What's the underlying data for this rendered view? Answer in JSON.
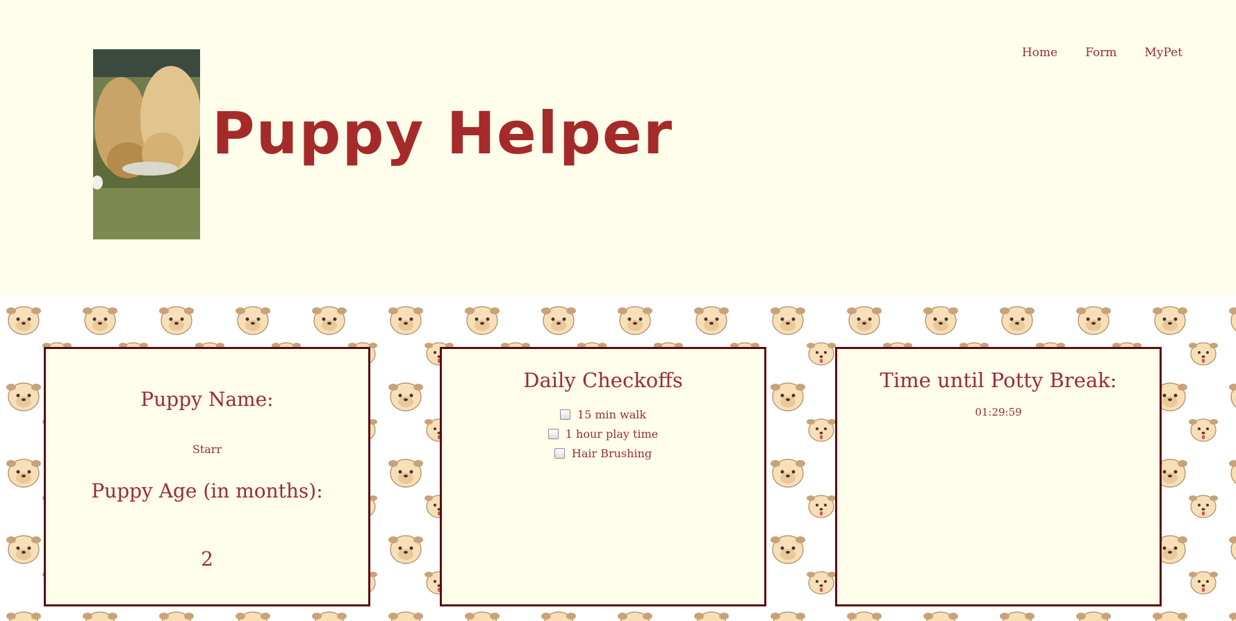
{
  "header": {
    "title": "Puppy Helper",
    "photo_alt": "Two golden retriever puppies eating from a bowl on grass"
  },
  "nav": {
    "items": [
      "Home",
      "Form",
      "MyPet"
    ]
  },
  "pet_card": {
    "name_label": "Puppy Name:",
    "name_value": "Starr",
    "age_label": "Puppy Age (in months):",
    "age_value": "2"
  },
  "checkoffs_card": {
    "title": "Daily Checkoffs",
    "items": [
      {
        "label": "15 min walk",
        "checked": false
      },
      {
        "label": "1 hour play time",
        "checked": false
      },
      {
        "label": "Hair Brushing",
        "checked": false
      }
    ]
  },
  "timer_card": {
    "title": "Time until Potty Break:",
    "countdown": "01:29:59"
  },
  "colors": {
    "background": "#fefeea",
    "title": "#a52a2a",
    "text": "#9b2a3a",
    "card_border": "#5a0a14",
    "pug_face": "#f7dfb8"
  }
}
